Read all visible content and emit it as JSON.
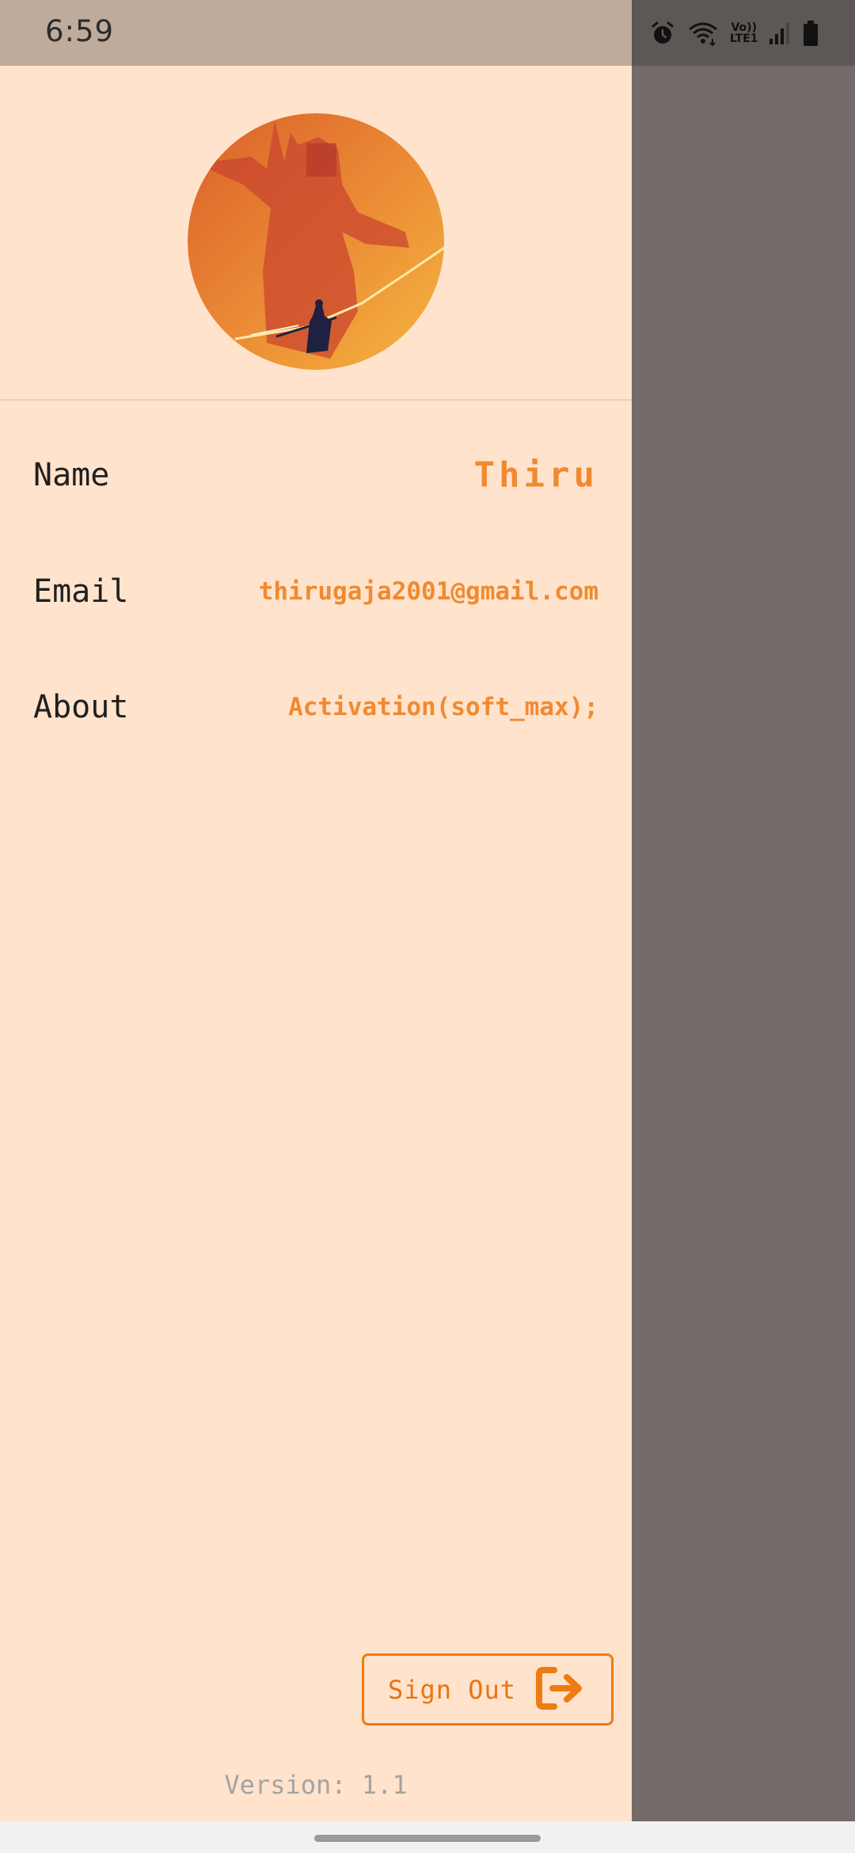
{
  "status_bar": {
    "time": "6:59",
    "network_label_top": "Vo))",
    "network_label_bottom": "LTE1",
    "icons": [
      "alarm-icon",
      "wifi-icon",
      "signal-icon",
      "battery-icon"
    ]
  },
  "profile": {
    "avatar": "avatar-image",
    "fields": {
      "name": {
        "label": "Name",
        "value": "Thiru"
      },
      "email": {
        "label": "Email",
        "value": "thirugaja2001@gmail.com"
      },
      "about": {
        "label": "About",
        "value": "Activation(soft_max);"
      }
    }
  },
  "footer": {
    "sign_out_label": "Sign Out",
    "sign_out_icon": "sign-out-icon",
    "version": "Version: 1.1"
  },
  "colors": {
    "drawer_bg": "#ffe3cc",
    "accent": "#f08a30",
    "button_border": "#f07b12",
    "scrim": "#736b69"
  }
}
